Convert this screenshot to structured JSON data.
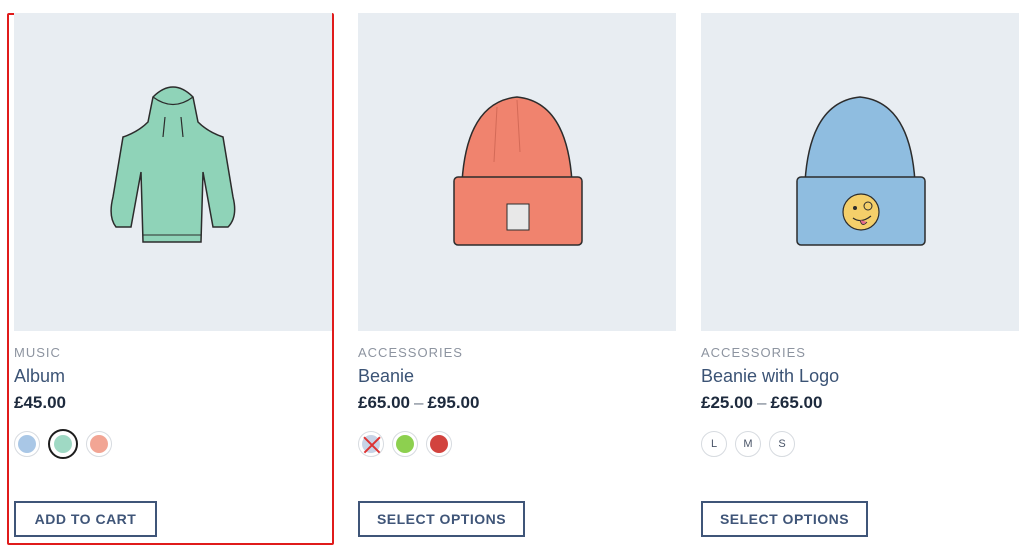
{
  "products": [
    {
      "category": "Music",
      "title": "Album",
      "price": "£45.00",
      "price_max": "",
      "swatches": [
        "blue-shirt-swatch",
        "teal-shirt-swatch",
        "peach-shirt-swatch"
      ],
      "button": "Add to cart"
    },
    {
      "category": "Accessories",
      "title": "Beanie",
      "price": "£65.00",
      "price_sep": "–",
      "price_max": "£95.00",
      "swatches": [
        "#c7d3e6",
        "#8dd04f",
        "#d2433e"
      ],
      "button": "Select options"
    },
    {
      "category": "Accessories",
      "title": "Beanie with Logo",
      "price": "£25.00",
      "price_sep": "–",
      "price_max": "£65.00",
      "sizes": [
        "L",
        "M",
        "S"
      ],
      "button": "Select options"
    }
  ],
  "colors": {
    "hoodie": "#8fd3b8",
    "beanie_orange": "#f0836e",
    "beanie_blue": "#8fbde0",
    "highlight": "#e01b1b"
  }
}
